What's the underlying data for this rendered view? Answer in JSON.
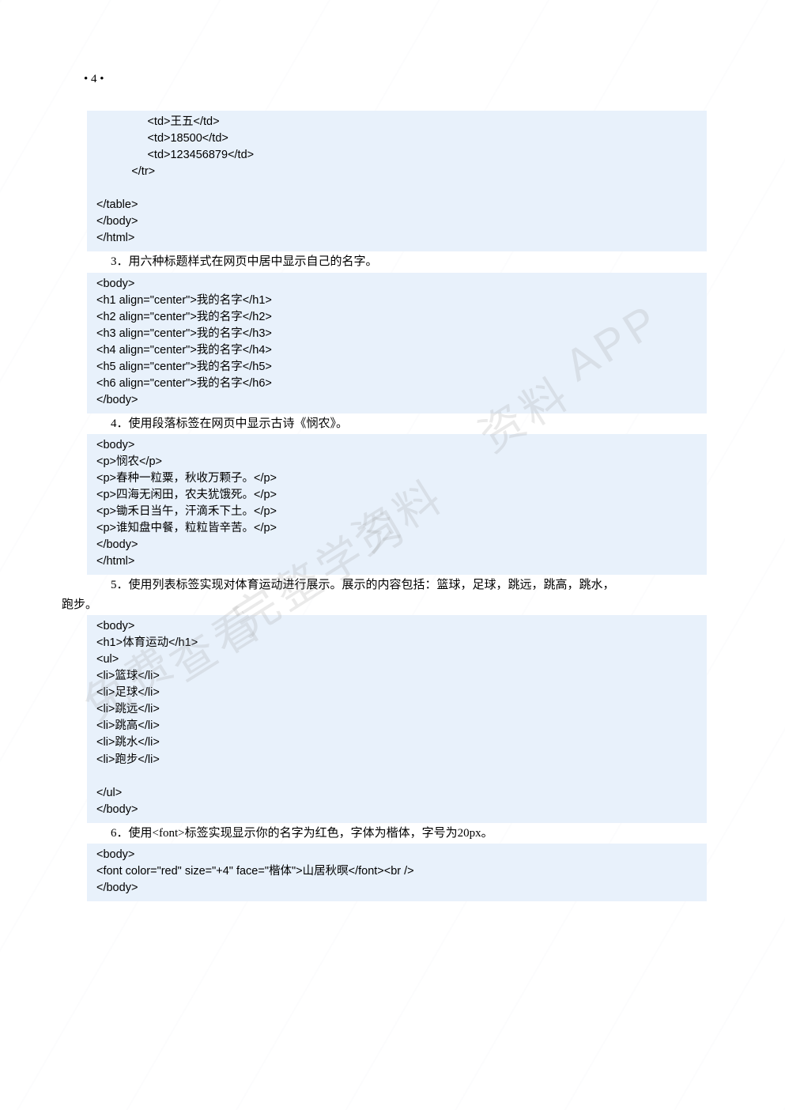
{
  "page": {
    "number": "• 4 •"
  },
  "watermark": {
    "t1": "资料",
    "t2": "完整学习",
    "t3": "资料",
    "t4": "查看",
    "t5": "APP",
    "t6": "免费"
  },
  "questions": {
    "q3": "3．用六种标题样式在网页中居中显示自己的名字。",
    "q4": "4．使用段落标签在网页中显示古诗《悯农》。",
    "q5a": "5．使用列表标签实现对体育运动进行展示。展示的内容包括：篮球，足球，跳远，跳高，跳水，",
    "q5b": "跑步。",
    "q6": "6．使用<font>标签实现显示你的名字为红色，字体为楷体，字号为20px。"
  },
  "blocks": [
    {
      "lines": [
        "                <td>王五</td>",
        "                <td>18500</td>",
        "                <td>123456879</td>",
        "           </tr>",
        "",
        "</table>",
        "</body>",
        "</html>"
      ]
    },
    {
      "lines": [
        "<body>",
        "<h1 align=\"center\">我的名字</h1>",
        "<h2 align=\"center\">我的名字</h2>",
        "<h3 align=\"center\">我的名字</h3>",
        "<h4 align=\"center\">我的名字</h4>",
        "<h5 align=\"center\">我的名字</h5>",
        "<h6 align=\"center\">我的名字</h6>",
        "</body>"
      ]
    },
    {
      "lines": [
        "<body>",
        "<p>悯农</p>",
        "<p>春种一粒粟，秋收万颗子。</p>",
        "<p>四海无闲田，农夫犹饿死。</p>",
        "<p>锄禾日当午，汗滴禾下土。</p>",
        "<p>谁知盘中餐，粒粒皆辛苦。</p>",
        "</body>",
        "</html>"
      ]
    },
    {
      "lines": [
        "<body>",
        "<h1>体育运动</h1>",
        "<ul>",
        "<li>篮球</li>",
        "<li>足球</li>",
        "<li>跳远</li>",
        "<li>跳高</li>",
        "<li>跳水</li>",
        "<li>跑步</li>",
        "",
        "</ul>",
        "</body>"
      ]
    },
    {
      "lines": [
        "<body>",
        "<font color=\"red\" size=\"+4\" face=\"楷体\">山居秋暝</font><br />",
        "</body>"
      ]
    }
  ]
}
